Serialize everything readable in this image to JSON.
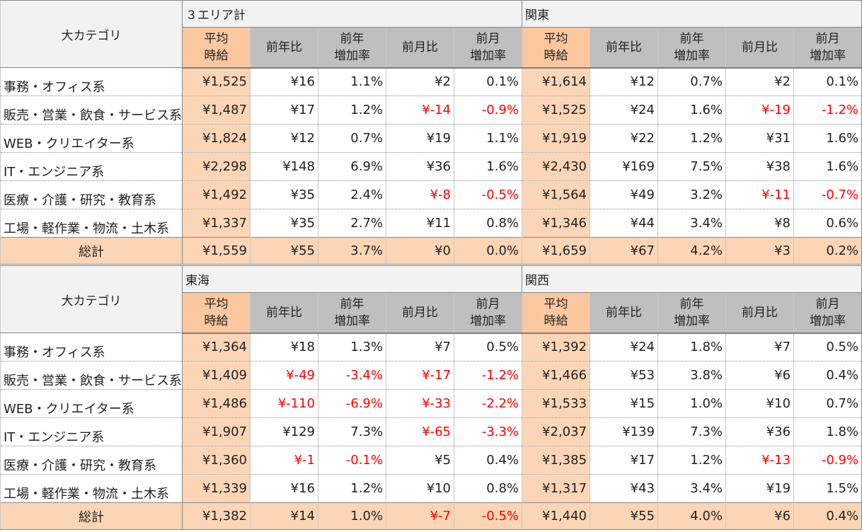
{
  "blocks": [
    {
      "category_header": "大カテゴリ",
      "regions": [
        {
          "name": "３エリア計",
          "headers": [
            "平均\n時給",
            "前年比",
            "前年\n増加率",
            "前月比",
            "前月\n増加率"
          ]
        },
        {
          "name": "関東",
          "headers": [
            "平均\n時給",
            "前年比",
            "前年\n増加率",
            "前月比",
            "前月\n増加率"
          ]
        }
      ],
      "rows": [
        {
          "label": "事務・オフィス系",
          "cells": [
            "¥1,525",
            "¥16",
            "1.1%",
            "¥2",
            "0.1%",
            "¥1,614",
            "¥12",
            "0.7%",
            "¥2",
            "0.1%"
          ]
        },
        {
          "label": "販売・営業・飲食・サービス系",
          "cells": [
            "¥1,487",
            "¥17",
            "1.2%",
            "¥-14",
            "-0.9%",
            "¥1,525",
            "¥24",
            "1.6%",
            "¥-19",
            "-1.2%"
          ]
        },
        {
          "label": "WEB・クリエイター系",
          "cells": [
            "¥1,824",
            "¥12",
            "0.7%",
            "¥19",
            "1.1%",
            "¥1,919",
            "¥22",
            "1.2%",
            "¥31",
            "1.6%"
          ]
        },
        {
          "label": "IT・エンジニア系",
          "cells": [
            "¥2,298",
            "¥148",
            "6.9%",
            "¥36",
            "1.6%",
            "¥2,430",
            "¥169",
            "7.5%",
            "¥38",
            "1.6%"
          ]
        },
        {
          "label": "医療・介護・研究・教育系",
          "cells": [
            "¥1,492",
            "¥35",
            "2.4%",
            "¥-8",
            "-0.5%",
            "¥1,564",
            "¥49",
            "3.2%",
            "¥-11",
            "-0.7%"
          ]
        },
        {
          "label": "工場・軽作業・物流・土木系",
          "cells": [
            "¥1,337",
            "¥35",
            "2.7%",
            "¥11",
            "0.8%",
            "¥1,346",
            "¥44",
            "3.4%",
            "¥8",
            "0.6%"
          ]
        }
      ],
      "total": {
        "label": "総計",
        "cells": [
          "¥1,559",
          "¥55",
          "3.7%",
          "¥0",
          "0.0%",
          "¥1,659",
          "¥67",
          "4.2%",
          "¥3",
          "0.2%"
        ]
      }
    },
    {
      "category_header": "大カテゴリ",
      "regions": [
        {
          "name": "東海",
          "headers": [
            "平均\n時給",
            "前年比",
            "前年\n増加率",
            "前月比",
            "前月\n増加率"
          ]
        },
        {
          "name": "関西",
          "headers": [
            "平均\n時給",
            "前年比",
            "前年\n増加率",
            "前月比",
            "前月\n増加率"
          ]
        }
      ],
      "rows": [
        {
          "label": "事務・オフィス系",
          "cells": [
            "¥1,364",
            "¥18",
            "1.3%",
            "¥7",
            "0.5%",
            "¥1,392",
            "¥24",
            "1.8%",
            "¥7",
            "0.5%"
          ]
        },
        {
          "label": "販売・営業・飲食・サービス系",
          "cells": [
            "¥1,409",
            "¥-49",
            "-3.4%",
            "¥-17",
            "-1.2%",
            "¥1,466",
            "¥53",
            "3.8%",
            "¥6",
            "0.4%"
          ]
        },
        {
          "label": "WEB・クリエイター系",
          "cells": [
            "¥1,486",
            "¥-110",
            "-6.9%",
            "¥-33",
            "-2.2%",
            "¥1,533",
            "¥15",
            "1.0%",
            "¥10",
            "0.7%"
          ]
        },
        {
          "label": "IT・エンジニア系",
          "cells": [
            "¥1,907",
            "¥129",
            "7.3%",
            "¥-65",
            "-3.3%",
            "¥2,037",
            "¥139",
            "7.3%",
            "¥36",
            "1.8%"
          ]
        },
        {
          "label": "医療・介護・研究・教育系",
          "cells": [
            "¥1,360",
            "¥-1",
            "-0.1%",
            "¥5",
            "0.4%",
            "¥1,385",
            "¥17",
            "1.2%",
            "¥-13",
            "-0.9%"
          ]
        },
        {
          "label": "工場・軽作業・物流・土木系",
          "cells": [
            "¥1,339",
            "¥16",
            "1.2%",
            "¥10",
            "0.8%",
            "¥1,317",
            "¥43",
            "3.4%",
            "¥19",
            "1.5%"
          ]
        }
      ],
      "total": {
        "label": "総計",
        "cells": [
          "¥1,382",
          "¥14",
          "1.0%",
          "¥-7",
          "-0.5%",
          "¥1,440",
          "¥55",
          "4.0%",
          "¥6",
          "0.4%"
        ]
      }
    }
  ],
  "colors": {
    "negative": "#ff0000",
    "avg_fill": "#fbd5b5",
    "header_gray": "#bfbfbf"
  }
}
